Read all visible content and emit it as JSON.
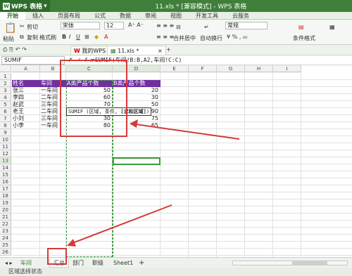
{
  "app": {
    "name": "WPS 表格",
    "window_title": "11.xls * [兼容模式] - WPS 表格"
  },
  "ribbon_tabs": [
    "开始",
    "插入",
    "页面布局",
    "公式",
    "数据",
    "审阅",
    "视图",
    "开发工具",
    "云服务"
  ],
  "toolbar": {
    "paste": "粘贴",
    "cut": "剪切",
    "copy": "复制",
    "format_painter": "格式刷",
    "font_name": "宋体",
    "font_size": "12",
    "merge_center": "合并居中",
    "wrap_text": "自动换行",
    "number_format": "常规",
    "conditional_format": "条件格式"
  },
  "doc_tabs": [
    {
      "label": "我的WPS"
    },
    {
      "label": "11.xls *"
    }
  ],
  "formula_bar": {
    "name_box": "SUMIF",
    "formula": "=SUMIF(车间!B:B,A2,车间!C:C)"
  },
  "columns": [
    "A",
    "B",
    "C",
    "D",
    "E",
    "F",
    "G",
    "H",
    "I"
  ],
  "rows": [
    "1",
    "2",
    "3",
    "4",
    "5",
    "6",
    "7",
    "8",
    "9",
    "10",
    "11",
    "12",
    "13",
    "14",
    "15",
    "16",
    "17",
    "18",
    "19",
    "20",
    "21",
    "22",
    "23",
    "24",
    "25",
    "26"
  ],
  "table": {
    "headers": [
      "姓名",
      "车间",
      "A类产品个数",
      "B类产品个数"
    ],
    "rows": [
      [
        "张三",
        "一车间",
        "50",
        "20"
      ],
      [
        "李四",
        "二车间",
        "60",
        "30"
      ],
      [
        "赵武",
        "三车间",
        "70",
        "50"
      ],
      [
        "老王",
        "二车间",
        "",
        "90"
      ],
      [
        "小刘",
        "三车间",
        "30",
        "75"
      ],
      [
        "小李",
        "一车间",
        "80",
        "65"
      ]
    ]
  },
  "tooltip": {
    "fn": "SUMIF (区域, 条件,",
    "bold": "[求和区域]",
    "end": ")"
  },
  "sheet_tabs": [
    "车间",
    "汇总",
    "部门",
    "职级",
    "Sheet1"
  ],
  "add_sheet": "+",
  "status": {
    "text": "区域选择状态"
  },
  "colors": {
    "accent": "#3f7f3a",
    "header_fill": "#7030a0",
    "annotation": "#d63a3a",
    "selection": "#3c9c3c"
  }
}
